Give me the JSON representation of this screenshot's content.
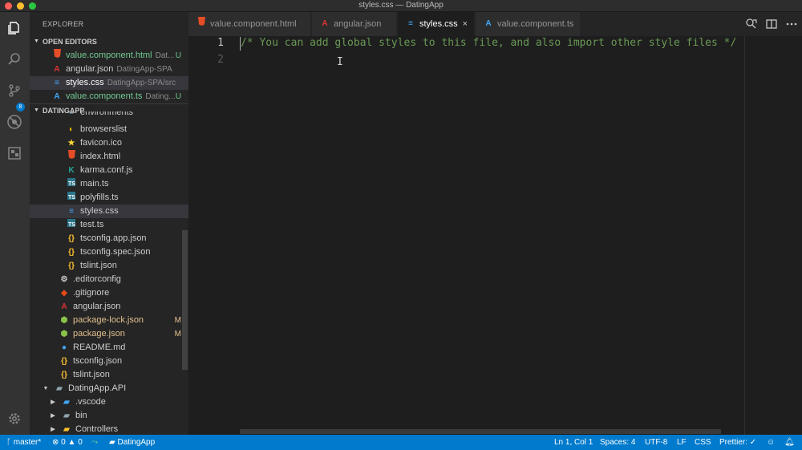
{
  "window": {
    "title": "styles.css — DatingApp"
  },
  "activity": {
    "scm_badge": "8"
  },
  "sidebar": {
    "title": "EXPLORER",
    "open_editors_header": "OPEN EDITORS",
    "open_editors": [
      {
        "name": "value.component.html",
        "desc": "Dat...",
        "status": "U",
        "icon": "html5-icon",
        "color": "#e44d26",
        "label_color": "#73c991"
      },
      {
        "name": "angular.json",
        "desc": "DatingApp-SPA",
        "status": "",
        "icon": "angular-icon",
        "color": "#dd3333",
        "label_color": "#cccccc"
      },
      {
        "name": "styles.css",
        "desc": "DatingApp-SPA/src",
        "status": "",
        "icon": "css3-icon",
        "color": "#42a5f5",
        "label_color": "#ffffff"
      },
      {
        "name": "value.component.ts",
        "desc": "Dating...",
        "status": "U",
        "icon": "angular-ts-icon",
        "color": "#42a5f5",
        "label_color": "#73c991"
      }
    ],
    "project_header": "DATINGAPP",
    "tree": [
      {
        "name": "environments",
        "color": "#cccccc"
      },
      {
        "name": "browserslist",
        "color": "#cccccc"
      },
      {
        "name": "favicon.ico",
        "color": "#cccccc"
      },
      {
        "name": "index.html",
        "color": "#cccccc"
      },
      {
        "name": "karma.conf.js",
        "color": "#cccccc"
      },
      {
        "name": "main.ts",
        "color": "#cccccc"
      },
      {
        "name": "polyfills.ts",
        "color": "#cccccc"
      },
      {
        "name": "styles.css",
        "color": "#cccccc"
      },
      {
        "name": "test.ts",
        "color": "#cccccc"
      },
      {
        "name": "tsconfig.app.json",
        "color": "#cccccc"
      },
      {
        "name": "tsconfig.spec.json",
        "color": "#cccccc"
      },
      {
        "name": "tslint.json",
        "color": "#cccccc"
      },
      {
        "name": ".editorconfig",
        "color": "#cccccc"
      },
      {
        "name": ".gitignore",
        "color": "#cccccc"
      },
      {
        "name": "angular.json",
        "color": "#cccccc"
      },
      {
        "name": "package-lock.json",
        "status": "M",
        "color": "#e2c08d"
      },
      {
        "name": "package.json",
        "status": "M",
        "color": "#e2c08d"
      },
      {
        "name": "README.md",
        "color": "#cccccc"
      },
      {
        "name": "tsconfig.json",
        "color": "#cccccc"
      },
      {
        "name": "tslint.json",
        "color": "#cccccc"
      },
      {
        "name": "DatingApp.API",
        "color": "#cccccc"
      },
      {
        "name": ".vscode",
        "color": "#cccccc"
      },
      {
        "name": "bin",
        "color": "#cccccc"
      },
      {
        "name": "Controllers",
        "color": "#cccccc"
      }
    ]
  },
  "tabs": [
    {
      "label": "value.component.html",
      "icon": "html5-icon",
      "active": false
    },
    {
      "label": "angular.json",
      "icon": "angular-icon",
      "active": false
    },
    {
      "label": "styles.css",
      "icon": "css3-icon",
      "active": true,
      "close": "×"
    },
    {
      "label": "value.component.ts",
      "icon": "angular-ts-icon",
      "active": false
    }
  ],
  "editor": {
    "lines": [
      {
        "number": "1",
        "text": "/* You can add global styles to this file, and also import other style files */"
      },
      {
        "number": "2",
        "text": ""
      }
    ],
    "ibeam": "I"
  },
  "status": {
    "branch": "master*",
    "errors": "0",
    "warnings": "0",
    "folder": "DatingApp",
    "position": "Ln 1, Col 1",
    "spaces": "Spaces: 4",
    "encoding": "UTF-8",
    "eol": "LF",
    "language": "CSS",
    "prettier": "Prettier: ✓"
  },
  "colors": {
    "accent": "#007acc",
    "modified": "#e2c08d",
    "untracked": "#73c991",
    "comment": "#6a9955"
  }
}
